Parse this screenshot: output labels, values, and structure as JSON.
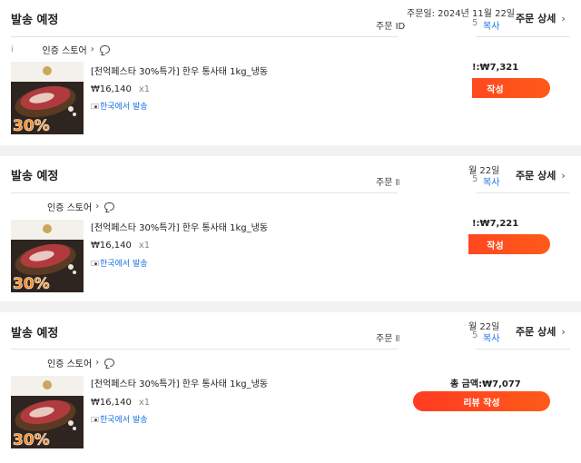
{
  "orders": [
    {
      "status": "발송 예정",
      "order_id_label": "주문 ID",
      "order_date": "주문일: 2024년 11월 22일",
      "copy": "복사",
      "copy_prefix": "5",
      "detail": "주문 상세",
      "store_dot": "i",
      "store": "인증 스토어",
      "product": "[천억페스타 30%특가] 한우 통사태 1kg_냉동",
      "price": "₩16,140",
      "qty": "x1",
      "ship": "한국에서 발송",
      "total": "!:₩7,321",
      "review": "작성"
    },
    {
      "status": "발송 예정",
      "order_id_label": "주문 ID",
      "order_date": "월 22일",
      "copy": "복사",
      "copy_prefix": "5",
      "detail": "주문 상세",
      "store_dot": "",
      "store": "인증 스토어",
      "product": "[천억페스타 30%특가] 한우 통사태 1kg_냉동",
      "price": "₩16,140",
      "qty": "x1",
      "ship": "한국에서 발송",
      "total": "!:₩7,221",
      "review": "작성"
    },
    {
      "status": "발송 예정",
      "order_id_label": "주문 ID",
      "order_date": "월 22일",
      "copy": "복사",
      "copy_prefix": "5",
      "detail": "주문 상세",
      "store_dot": "",
      "store": "인증 스토어",
      "product": "[천억페스타 30%특가] 한우 통사태 1kg_냉동",
      "price": "₩16,140",
      "qty": "x1",
      "ship": "한국에서 발송",
      "total": "총 금액:₩7,077",
      "review": "리뷰 작성"
    }
  ],
  "thumb_badge": "30%",
  "colors": {
    "accent": "#ff4422",
    "link": "#1a73e8"
  },
  "icons": {
    "chat": "chat-icon",
    "chevron": "chevron-right-icon",
    "flag": "korea-flag-icon"
  }
}
